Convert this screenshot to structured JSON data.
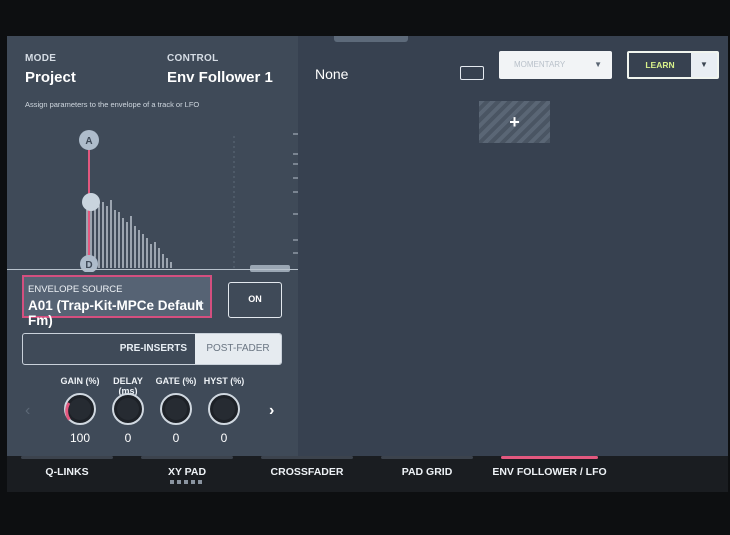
{
  "header": {
    "mode_label": "MODE",
    "mode_value": "Project",
    "control_label": "CONTROL",
    "control_value": "Env Follower 1",
    "description": "Assign parameters to the envelope of a track or LFO"
  },
  "graph": {
    "marker_a": "A",
    "marker_d": "D"
  },
  "envelope_source": {
    "label": "ENVELOPE SOURCE",
    "value": "A01 (Trap-Kit-MPCe Default Fm)"
  },
  "on_button": {
    "label": "ON"
  },
  "insert_toggle": {
    "pre": "PRE-INSERTS",
    "post": "POST-FADER",
    "selected": "POST-FADER"
  },
  "knobs": [
    {
      "label": "GAIN (%)",
      "value": "100",
      "level": 1.0
    },
    {
      "label": "DELAY (ms)",
      "value": "0",
      "level": 0.0
    },
    {
      "label": "GATE (%)",
      "value": "0",
      "level": 0.0
    },
    {
      "label": "HYST (%)",
      "value": "0",
      "level": 0.0
    }
  ],
  "right": {
    "target_name": "None",
    "mode_dropdown": "MOMENTARY",
    "learn_label": "LEARN",
    "add_symbol": "+"
  },
  "tabs": [
    {
      "label": "Q-LINKS",
      "active": false
    },
    {
      "label": "XY PAD",
      "active": false
    },
    {
      "label": "CROSSFADER",
      "active": false
    },
    {
      "label": "PAD GRID",
      "active": false
    },
    {
      "label": "ENV FOLLOWER / LFO",
      "active": true
    }
  ],
  "colors": {
    "accent_pink": "#e3587f",
    "learn_green": "#d8f08a",
    "panel": "#3f4a58"
  }
}
